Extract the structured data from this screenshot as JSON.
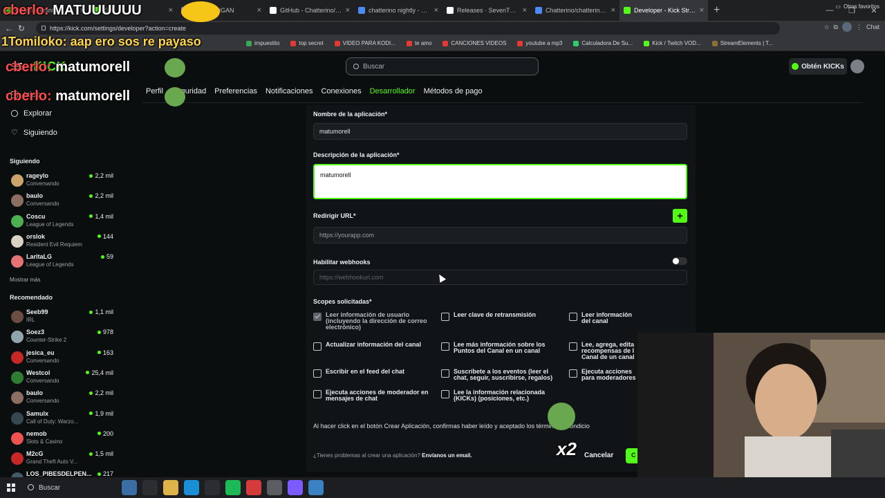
{
  "browser": {
    "tabs": [
      {
        "title": "Channel Points",
        "color": "#53fc18"
      },
      {
        "title": "Kick",
        "color": "#53fc18"
      },
      {
        "title": "LIGA GENGAN",
        "color": "#7d5cff"
      },
      {
        "title": "GitHub - Chatterino/chatter",
        "color": "#ffffff"
      },
      {
        "title": "chatterino nightly - Búsque",
        "color": "#4c8bf5"
      },
      {
        "title": "Releases · SevenTV/chatter",
        "color": "#ffffff"
      },
      {
        "title": "Chatterino/chatterino2 nigh",
        "color": "#4c8bf5"
      },
      {
        "title": "Developer - Kick Streaming",
        "color": "#53fc18"
      }
    ],
    "url": "https://kick.com/settings/developer?action=create",
    "bookmarks": [
      {
        "label": "impuestito",
        "color": "#3aa757"
      },
      {
        "label": "top secret",
        "color": "#e53935"
      },
      {
        "label": "VIDEO PARA KODI...",
        "color": "#e53935"
      },
      {
        "label": "te amo",
        "color": "#e53935"
      },
      {
        "label": "CANCIONES VIDEOS",
        "color": "#e53935"
      },
      {
        "label": "youtube a mp3",
        "color": "#e53935"
      },
      {
        "label": "Calculadora De Su...",
        "color": "#2ecc71"
      },
      {
        "label": "Kick / Twitch VOD...",
        "color": "#53fc18"
      },
      {
        "label": "StreamElements | T...",
        "color": "#8a6d3b"
      }
    ],
    "other_bookmarks": "Otros favoritos",
    "chat_button": "Chat"
  },
  "header": {
    "search_placeholder": "Buscar",
    "kicks_button": "Obtén KICKs"
  },
  "sidebar": {
    "nav": [
      "Inicio",
      "Explorar",
      "Siguiendo"
    ],
    "following_title": "Siguiendo",
    "following": [
      {
        "name": "rageylo",
        "category": "Conversando",
        "viewers": "2,2 mil",
        "color": "#c9a46b"
      },
      {
        "name": "baulo",
        "category": "Conversando",
        "viewers": "2,2 mil",
        "color": "#8d6e63"
      },
      {
        "name": "Coscu",
        "category": "League of Legends",
        "viewers": "1,4 mil",
        "color": "#4caf50"
      },
      {
        "name": "orslok",
        "category": "Resident Evil Requiem",
        "viewers": "144",
        "color": "#d8d1c4"
      },
      {
        "name": "LaritaLG",
        "category": "League of Legends",
        "viewers": "59",
        "color": "#e57373"
      }
    ],
    "show_more": "Mostrar más",
    "recommended_title": "Recomendado",
    "recommended": [
      {
        "name": "Seeb99",
        "category": "IRL",
        "viewers": "1,1 mil",
        "color": "#6d4c41"
      },
      {
        "name": "Soez3",
        "category": "Counter-Strike 2",
        "viewers": "978",
        "color": "#90a4ae"
      },
      {
        "name": "jesica_eu",
        "category": "Conversando",
        "viewers": "163",
        "color": "#c62828"
      },
      {
        "name": "Westcol",
        "category": "Conversando",
        "viewers": "25,4 mil",
        "color": "#2e7d32"
      },
      {
        "name": "baulo",
        "category": "Conversando",
        "viewers": "2,2 mil",
        "color": "#8d6e63"
      },
      {
        "name": "Samulx",
        "category": "Call of Duty: Warzo...",
        "viewers": "1,9 mil",
        "color": "#37474f"
      },
      {
        "name": "nemob",
        "category": "Slots & Casino",
        "viewers": "200",
        "color": "#ef5350"
      },
      {
        "name": "M2cG",
        "category": "Grand Theft Auto V...",
        "viewers": "1,5 mil",
        "color": "#c62828"
      },
      {
        "name": "LOS_PIBESDELPEN...",
        "category": "",
        "viewers": "217",
        "color": "#455a64"
      }
    ]
  },
  "settings_tabs": [
    "Perfil",
    "Seguridad",
    "Preferencias",
    "Notificaciones",
    "Conexiones",
    "Desarrollador",
    "Métodos de pago"
  ],
  "form": {
    "app_name_label": "Nombre de la aplicación*",
    "app_name_value": "matumorell",
    "app_desc_label": "Descripción de la aplicación*",
    "app_desc_value": "matumorell",
    "redirect_label": "Redirigir URL*",
    "redirect_placeholder": "https://yourapp.com",
    "webhooks_label": "Habilitar webhooks",
    "webhooks_placeholder": "https://webhookurl.com",
    "scopes_label": "Scopes solicitadas*",
    "scopes": [
      {
        "label": "Leer información de usuario (incluyendo la dirección de correo electrónico)",
        "checked": true
      },
      {
        "label": "Leer clave de retransmisión",
        "checked": false
      },
      {
        "label": "Leer información del canal",
        "checked": false
      },
      {
        "label": "Actualizar información del canal",
        "checked": false
      },
      {
        "label": "Lee más información sobre los Puntos del Canal en un canal",
        "checked": false
      },
      {
        "label": "Lee, agrega, edita recompensas de l Canal de un canal",
        "checked": false
      },
      {
        "label": "Escribir en el feed del chat",
        "checked": false
      },
      {
        "label": "Suscríbete a los eventos (leer el chat, seguir, suscribirse, regalos)",
        "checked": false
      },
      {
        "label": "Ejecuta acciones para moderadores",
        "checked": false
      },
      {
        "label": "Ejecuta acciones de moderador en mensajes de chat",
        "checked": false
      },
      {
        "label": "Lee la información relacionada (KICKs) (posiciones, etc.)",
        "checked": false
      }
    ],
    "terms_text": "Al hacer click en el botón Crear Aplicación, confirmas haber leído y aceptado los términos y condicio",
    "help_text": "¿Tienes problemas al crear una aplicación?",
    "help_link": "Envíanos un email.",
    "cancel_button": "Cancelar",
    "create_button": "C"
  },
  "overlay": {
    "line1_user": "cberlo:",
    "line1_msg": "MATUUUUUU",
    "line2": "1Tomiloko: aap ero sos re payaso",
    "line3_user": "cberlo:",
    "line3_msg": "matumorell",
    "line4_user": "cberlo:",
    "line4_msg": "matumorell",
    "x2": "x2"
  },
  "taskbar": {
    "search": "Buscar"
  }
}
